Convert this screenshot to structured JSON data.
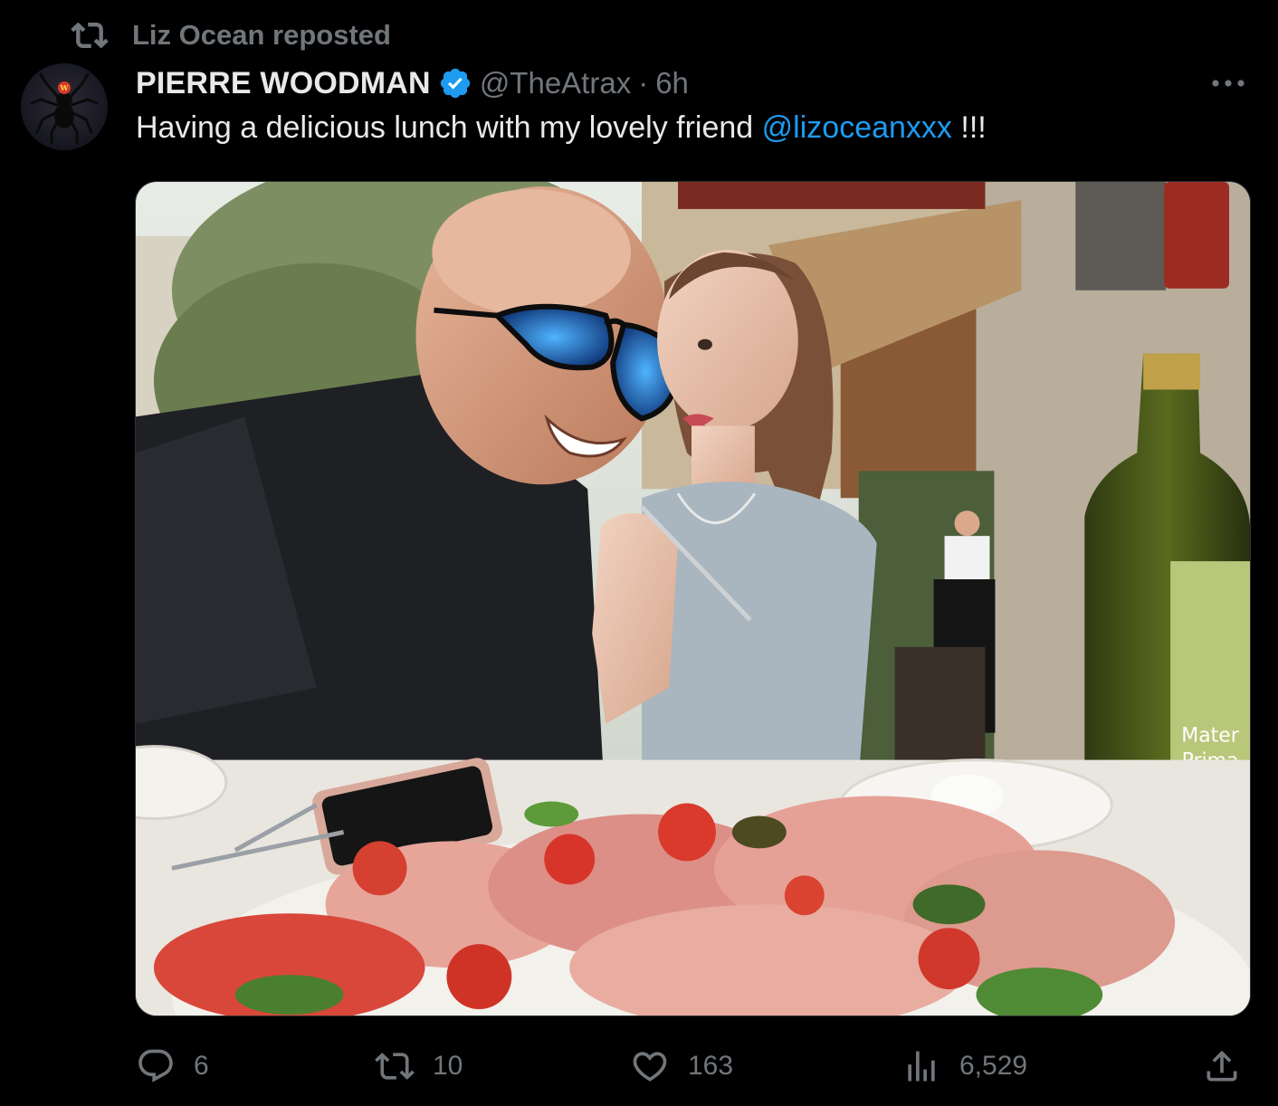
{
  "repost": {
    "label": "Liz Ocean reposted",
    "icon": "repost-icon"
  },
  "author": {
    "display_name": "PIERRE WOODMAN",
    "handle": "@TheAtrax",
    "separator": "·",
    "time": "6h",
    "verified": true,
    "avatar_icon": "spider-icon"
  },
  "tweet": {
    "text_before": "Having a delicious lunch with my lovely friend ",
    "mention": "@lizoceanxxx",
    "text_after": " !!!"
  },
  "media": {
    "bottle_label_lines": [
      "Mater",
      "Prima"
    ]
  },
  "actions": {
    "replies": "6",
    "reposts": "10",
    "likes": "163",
    "views": "6,529"
  },
  "colors": {
    "background": "#000000",
    "text_primary": "#e7e9ea",
    "text_secondary": "#71767b",
    "accent": "#1d9bf0"
  }
}
